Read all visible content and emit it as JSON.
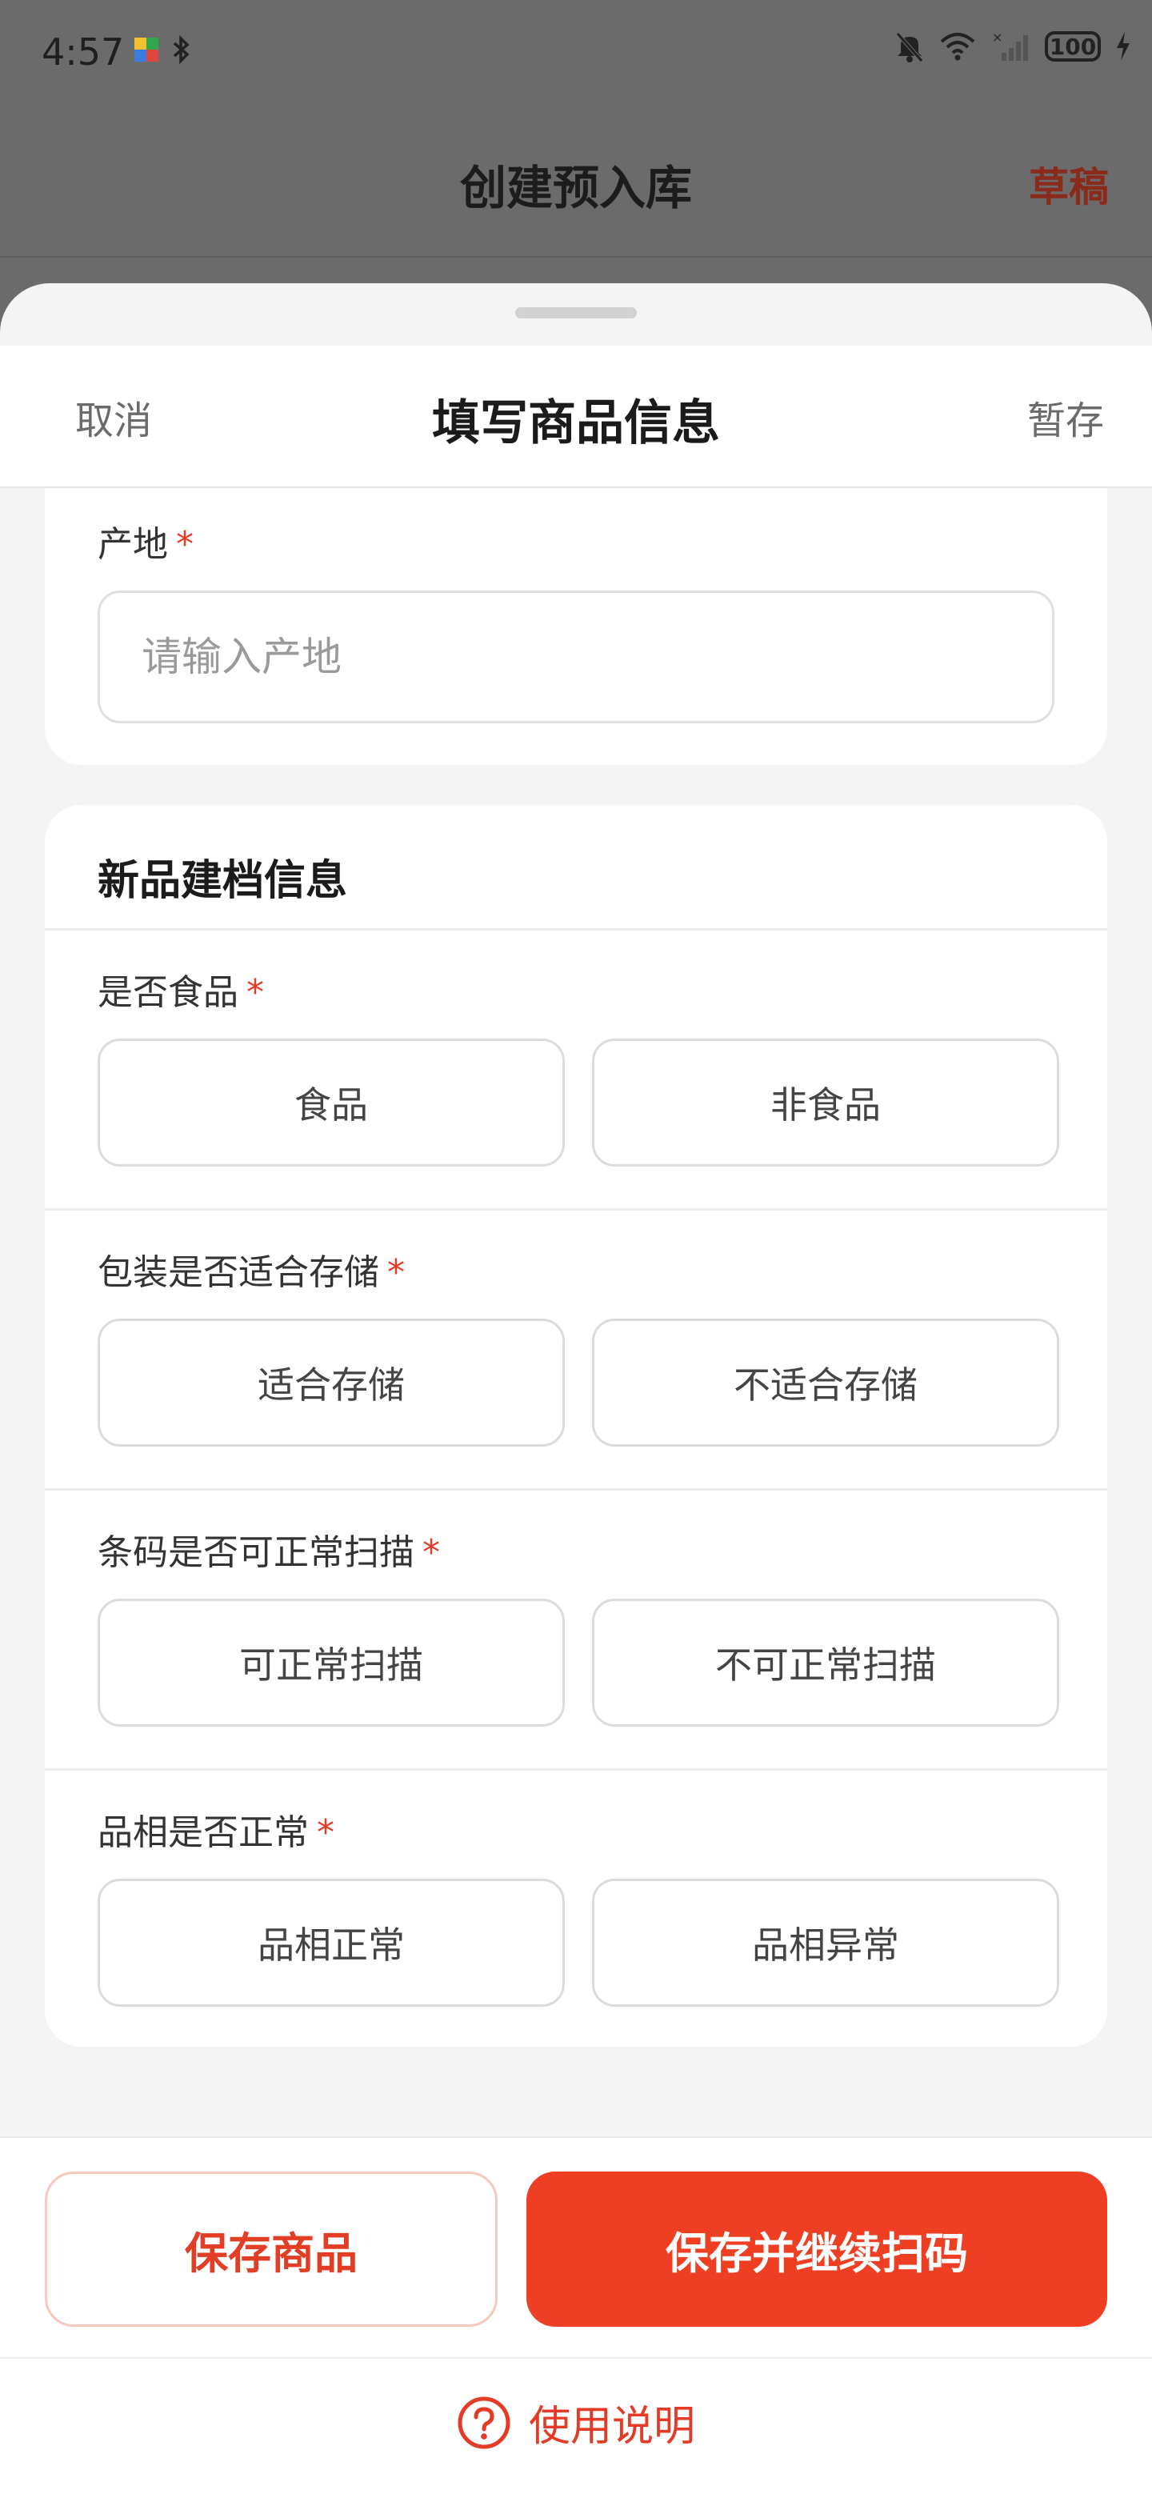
{
  "status_bar": {
    "time": "4:57",
    "battery": "100"
  },
  "background_page": {
    "title": "创建预入库",
    "draft_label": "草稿"
  },
  "sheet": {
    "cancel_label": "取消",
    "title": "填写商品信息",
    "save_draft_label": "暂存"
  },
  "origin_field": {
    "label": "产地",
    "required_mark": "*",
    "placeholder": "请输入产地",
    "value": ""
  },
  "new_product_section": {
    "title": "新品建档信息",
    "questions": [
      {
        "label": "是否食品",
        "required_mark": "*",
        "options": [
          "食品",
          "非食品"
        ]
      },
      {
        "label": "包装是否适合存储",
        "required_mark": "*",
        "options": [
          "适合存储",
          "不适合存储"
        ]
      },
      {
        "label": "条码是否可正常扫描",
        "required_mark": "*",
        "options": [
          "可正常扫描",
          "不可正常扫描"
        ]
      },
      {
        "label": "品相是否正常",
        "required_mark": "*",
        "options": [
          "品相正常",
          "品相异常"
        ]
      }
    ]
  },
  "footer": {
    "save_label": "保存商品",
    "save_continue_label": "保存并继续扫码",
    "help_label": "使用说明"
  },
  "colors": {
    "accent": "#ee3f23",
    "required": "#e43a26",
    "draft": "#8a2a1a"
  }
}
